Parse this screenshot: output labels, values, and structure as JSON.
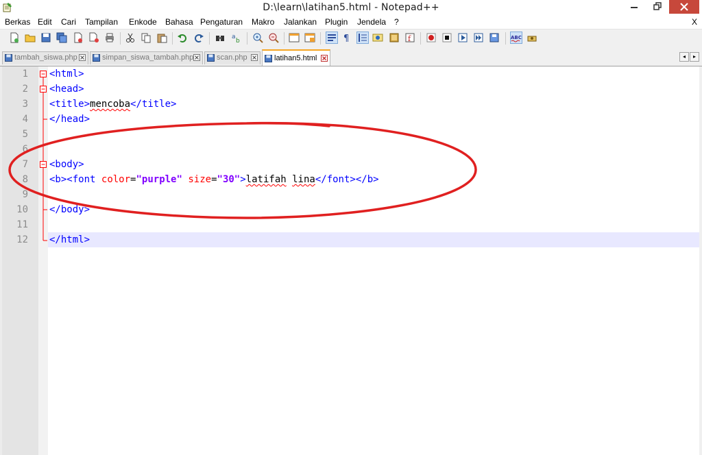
{
  "window": {
    "title": "D:\\learn\\latihan5.html - Notepad++",
    "minimize_glyph": "—",
    "restore_glyph": "❐",
    "close_glyph": "✕"
  },
  "menu": {
    "items": [
      "Berkas",
      "Edit",
      "Cari",
      "Tampilan",
      "Enkode",
      "Bahasa",
      "Pengaturan",
      "Makro",
      "Jalankan",
      "Plugin",
      "Jendela",
      "?"
    ],
    "close_label": "X"
  },
  "tabs": [
    {
      "label": "tambah_siswa.php",
      "active": false
    },
    {
      "label": "simpan_siswa_tambah.php",
      "active": false
    },
    {
      "label": "scan.php",
      "active": false
    },
    {
      "label": "latihan5.html",
      "active": true
    }
  ],
  "tab_scroll": {
    "left": "◂",
    "right": "▸"
  },
  "editor": {
    "line_numbers": [
      "1",
      "2",
      "3",
      "4",
      "5",
      "6",
      "7",
      "8",
      "9",
      "10",
      "11",
      "12"
    ],
    "lines": {
      "l1": "<html>",
      "l2": "<head>",
      "l3_open": "<title>",
      "l3_text": "mencoba",
      "l3_close": "</title>",
      "l4": "</head>",
      "l7": "<body>",
      "l8_b_open": "<b>",
      "l8_font_open": "<font",
      "l8_attr1": "color",
      "l8_eq": "=",
      "l8_val1": "\"purple\"",
      "l8_attr2": "size",
      "l8_val2": "\"30\"",
      "l8_gt": ">",
      "l8_text1": "latifah",
      "l8_text2": "lina",
      "l8_font_close": "</font>",
      "l8_b_close": "</b>",
      "l10": "</body>",
      "l12": "</html>"
    }
  },
  "colors": {
    "tag": "#0000ff",
    "attribute": "#ff0000",
    "string": "#8000ff",
    "text": "#000000",
    "line_number": "#8c8c8c",
    "caret_line": "#e8e8ff",
    "annotation_ellipse": "#e02020",
    "active_tab_accent": "#f5a623",
    "close_button": "#c7483b"
  },
  "icons": {
    "app": "notepad-icon",
    "toolbar": [
      "new-file-icon",
      "open-file-icon",
      "save-icon",
      "save-all-icon",
      "close-file-icon",
      "close-all-icon",
      "print-icon",
      "cut-icon",
      "copy-icon",
      "paste-icon",
      "undo-icon",
      "redo-icon",
      "find-icon",
      "replace-icon",
      "zoom-in-icon",
      "zoom-out-icon",
      "sync-vertical-icon",
      "sync-horizontal-icon",
      "word-wrap-icon",
      "show-all-chars-icon",
      "indent-guide-icon",
      "user-lang-icon",
      "doc-map-icon",
      "function-list-icon",
      "record-macro-icon",
      "stop-macro-icon",
      "play-macro-icon",
      "run-macro-multiple-icon",
      "save-macro-icon",
      "spell-check-icon",
      "spell-settings-icon"
    ]
  }
}
